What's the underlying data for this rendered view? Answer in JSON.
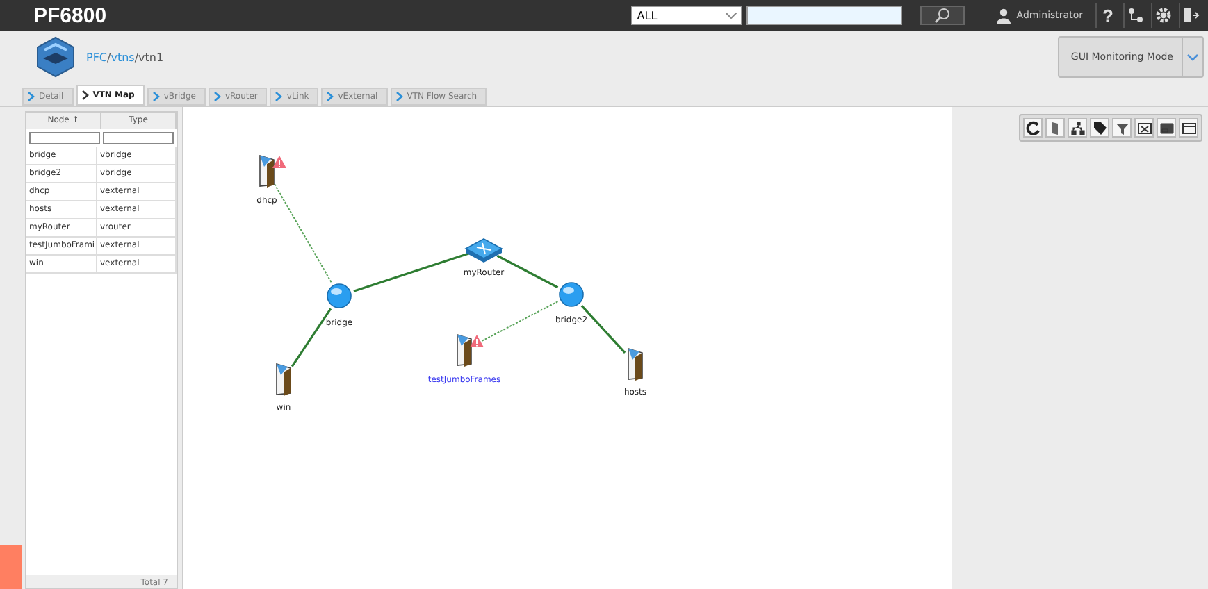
{
  "app_title": "PF6800",
  "header": {
    "scope": "ALL",
    "user": "Administrator",
    "help": "?"
  },
  "breadcrumb": [
    {
      "label": "PFC",
      "kind": "link"
    },
    {
      "label": "/",
      "kind": "separator"
    },
    {
      "label": "vtns",
      "kind": "link"
    },
    {
      "label": "/",
      "kind": "separator"
    },
    {
      "label": "vtn1",
      "kind": "current"
    }
  ],
  "mode_button": "GUI Monitoring Mode",
  "tabs": [
    {
      "label": "Detail",
      "selected": false
    },
    {
      "label": "VTN Map",
      "selected": true
    },
    {
      "label": "vBridge",
      "selected": false
    },
    {
      "label": "vRouter",
      "selected": false
    },
    {
      "label": "vLink",
      "selected": false
    },
    {
      "label": "vExternal",
      "selected": false
    },
    {
      "label": "VTN Flow Search",
      "selected": false
    }
  ],
  "node_table": {
    "columns": [
      "Node ↑",
      "Type"
    ],
    "rows": [
      {
        "node": "bridge",
        "type": "vbridge"
      },
      {
        "node": "bridge2",
        "type": "vbridge"
      },
      {
        "node": "dhcp",
        "type": "vexternal"
      },
      {
        "node": "hosts",
        "type": "vexternal"
      },
      {
        "node": "myRouter",
        "type": "vrouter"
      },
      {
        "node": "testJumboFrami",
        "type": "vexternal"
      },
      {
        "node": "win",
        "type": "vexternal"
      }
    ],
    "total": "Total 7"
  },
  "map": {
    "nodes": [
      {
        "label": "dhcp",
        "kind": "vexternal",
        "warning": true,
        "selected": false
      },
      {
        "label": "myRouter",
        "kind": "vrouter",
        "warning": false,
        "selected": false
      },
      {
        "label": "bridge",
        "kind": "vbridge",
        "warning": false,
        "selected": false
      },
      {
        "label": "bridge2",
        "kind": "vbridge",
        "warning": false,
        "selected": false
      },
      {
        "label": "testJumboFrames",
        "kind": "vexternal",
        "warning": true,
        "selected": true
      },
      {
        "label": "win",
        "kind": "vexternal",
        "warning": false,
        "selected": false
      },
      {
        "label": "hosts",
        "kind": "vexternal",
        "warning": false,
        "selected": false
      }
    ]
  }
}
